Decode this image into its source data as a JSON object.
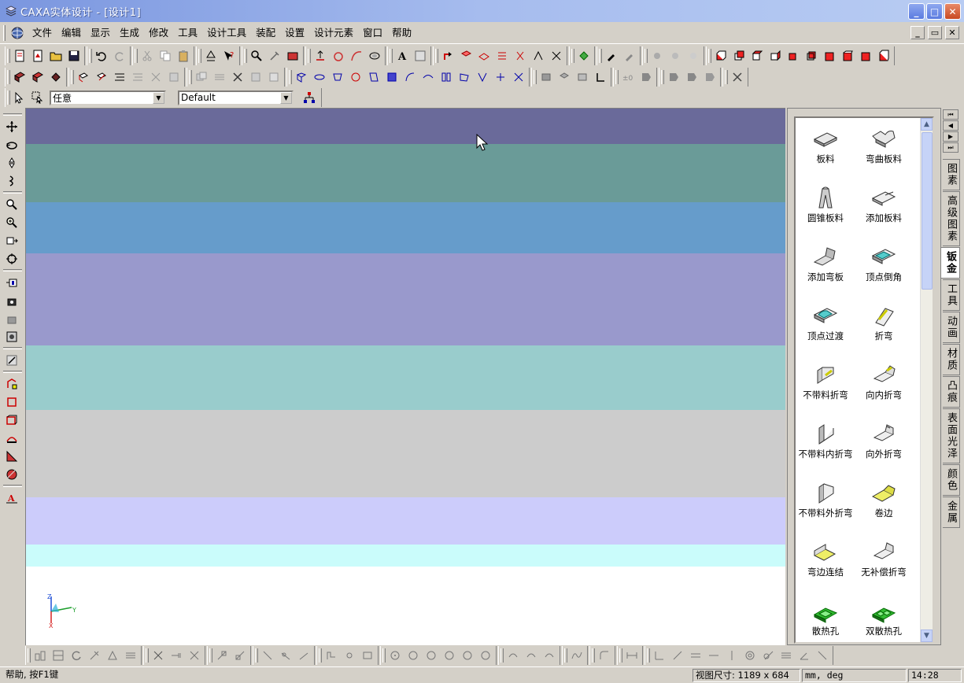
{
  "window": {
    "title": "CAXA实体设计 - [设计1]"
  },
  "menu": [
    "文件",
    "编辑",
    "显示",
    "生成",
    "修改",
    "工具",
    "设计工具",
    "装配",
    "设置",
    "设计元素",
    "窗口",
    "帮助"
  ],
  "selectors": {
    "filter_value": "任意",
    "style_value": "Default"
  },
  "viewport": {
    "axis_labels": {
      "z": "Z",
      "y": "Y",
      "x": "X"
    },
    "bands": [
      {
        "color": "#6a6a9a"
      },
      {
        "color": "#6a9b98"
      },
      {
        "color": "#669ccb"
      },
      {
        "color": "#9999cc"
      },
      {
        "color": "#99cccc"
      },
      {
        "color": "#cccccc"
      },
      {
        "color": "#ccccfb"
      },
      {
        "color": "#cafcfb"
      }
    ]
  },
  "library": {
    "items": [
      {
        "label": "板料",
        "icon": "sheet-icon"
      },
      {
        "label": "弯曲板料",
        "icon": "bent-sheet-icon"
      },
      {
        "label": "圆锥板料",
        "icon": "cone-sheet-icon"
      },
      {
        "label": "添加板料",
        "icon": "add-sheet-icon"
      },
      {
        "label": "添加弯板",
        "icon": "add-bend-plate-icon"
      },
      {
        "label": "顶点倒角",
        "icon": "vertex-chamfer-icon"
      },
      {
        "label": "顶点过渡",
        "icon": "vertex-fillet-icon"
      },
      {
        "label": "折弯",
        "icon": "fold-icon"
      },
      {
        "label": "不带料折弯",
        "icon": "bend-no-material-icon"
      },
      {
        "label": "向内折弯",
        "icon": "bend-inward-icon"
      },
      {
        "label": "不带料内折弯",
        "icon": "inner-bend-no-material-icon"
      },
      {
        "label": "向外折弯",
        "icon": "bend-outward-icon"
      },
      {
        "label": "不带料外折弯",
        "icon": "outer-bend-no-material-icon"
      },
      {
        "label": "卷边",
        "icon": "hem-icon"
      },
      {
        "label": "弯边连结",
        "icon": "flange-joint-icon"
      },
      {
        "label": "无补偿折弯",
        "icon": "uncompensated-bend-icon"
      },
      {
        "label": "散热孔",
        "icon": "vent-hole-icon"
      },
      {
        "label": "双散热孔",
        "icon": "double-vent-hole-icon"
      }
    ]
  },
  "side_tabs": [
    "图素",
    "高级图素",
    "钣金",
    "工具",
    "动画",
    "材质",
    "凸痕",
    "表面光泽",
    "颜色",
    "金属"
  ],
  "active_side_tab": "钣金",
  "status": {
    "help": "帮助, 按F1键",
    "view_size": "视图尺寸: 1189 x  684",
    "units": "mm, deg",
    "time": "14:28"
  }
}
